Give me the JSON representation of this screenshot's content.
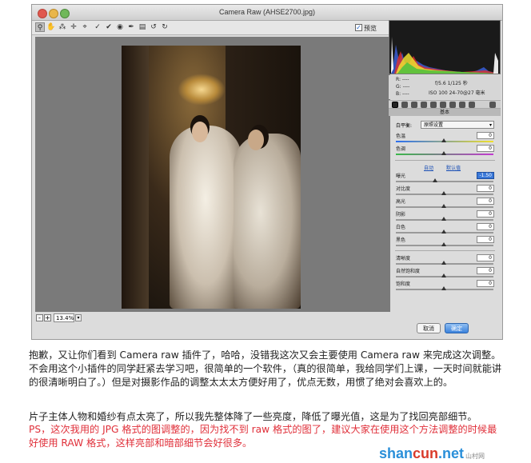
{
  "window": {
    "title": "Camera Raw (AHSE2700.jpg)",
    "preview_label": "预览",
    "zoom": "13.4%"
  },
  "toolbar": {
    "tools": [
      "zoom-icon",
      "hand-icon",
      "white-balance-icon",
      "color-sampler-icon",
      "crop-icon",
      "straighten-icon",
      "spot-removal-icon",
      "red-eye-icon",
      "brush-icon",
      "gradient-icon",
      "rotate-icon",
      "rotate-icon"
    ]
  },
  "info": {
    "r": "R: ----",
    "g": "G: ----",
    "b": "B: ----",
    "aperture": "f/5.6   1/125 秒",
    "iso": "ISO 100   24-70@27 毫米"
  },
  "panel": {
    "heading": "基本",
    "wb_label": "白平衡:",
    "wb_value": "原照设置",
    "auto": "自动",
    "default": "默认值",
    "controls": [
      {
        "label": "色温",
        "value": "0"
      },
      {
        "label": "色调",
        "value": "0"
      },
      {
        "label": "曝光",
        "value": "-1.50"
      },
      {
        "label": "对比度",
        "value": "0"
      },
      {
        "label": "高光",
        "value": "0"
      },
      {
        "label": "阴影",
        "value": "0"
      },
      {
        "label": "白色",
        "value": "0"
      },
      {
        "label": "黑色",
        "value": "0"
      },
      {
        "label": "清晰度",
        "value": "0"
      },
      {
        "label": "自然饱和度",
        "value": "0"
      },
      {
        "label": "饱和度",
        "value": "0"
      }
    ]
  },
  "buttons": {
    "cancel": "取消",
    "done": "确定"
  },
  "article": {
    "p1": "抱歉，又让你们看到 Camera raw 插件了，哈哈，没错我这次又会主要使用 Camera raw 来完成这次调整。不会用这个小插件的同学赶紧去学习吧，很简单的一个软件，（真的很简单，我给同学们上课，一天时间就能讲的很清晰明白了。）但是对摄影作品的调整太太太方便好用了，优点无数，用惯了绝对会喜欢上的。",
    "p2": "片子主体人物和婚纱有点太亮了，所以我先整体降了一些亮度，降低了曝光值，这是为了找回亮部细节。",
    "p3": "PS，这次我用的 JPG 格式的图调整的，因为找不到 raw 格式的图了，建议大家在使用这个方法调整的时候最好使用 RAW 格式，这样亮部和暗部细节会好很多。"
  },
  "watermark": {
    "main": "shan",
    "cn": "cun",
    "domain": ".net",
    "sub": "山村网"
  }
}
